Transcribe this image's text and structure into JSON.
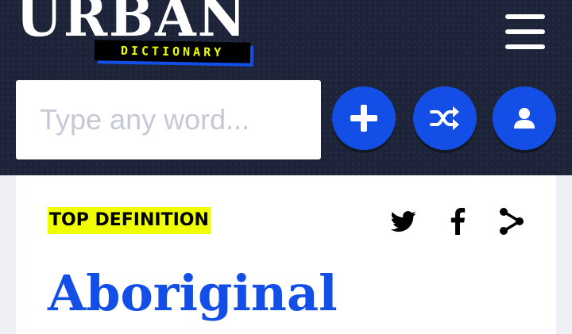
{
  "header": {
    "logo": {
      "word": "urban",
      "subtitle": "DICTIONARY"
    },
    "menu_icon": "hamburger-menu-icon",
    "search": {
      "placeholder": "Type any word..."
    },
    "buttons": [
      {
        "name": "add-definition-button",
        "icon": "plus-icon"
      },
      {
        "name": "random-word-button",
        "icon": "shuffle-icon"
      },
      {
        "name": "user-account-button",
        "icon": "user-icon"
      }
    ]
  },
  "definition": {
    "badge": "TOP DEFINITION",
    "share_icons": [
      "twitter-icon",
      "facebook-icon",
      "share-icon"
    ],
    "word": "Aboriginal"
  },
  "colors": {
    "header_bg": "#1d2439",
    "accent_blue": "#134fe6",
    "highlight_yellow": "#efff00",
    "page_bg": "#eef0f5"
  }
}
